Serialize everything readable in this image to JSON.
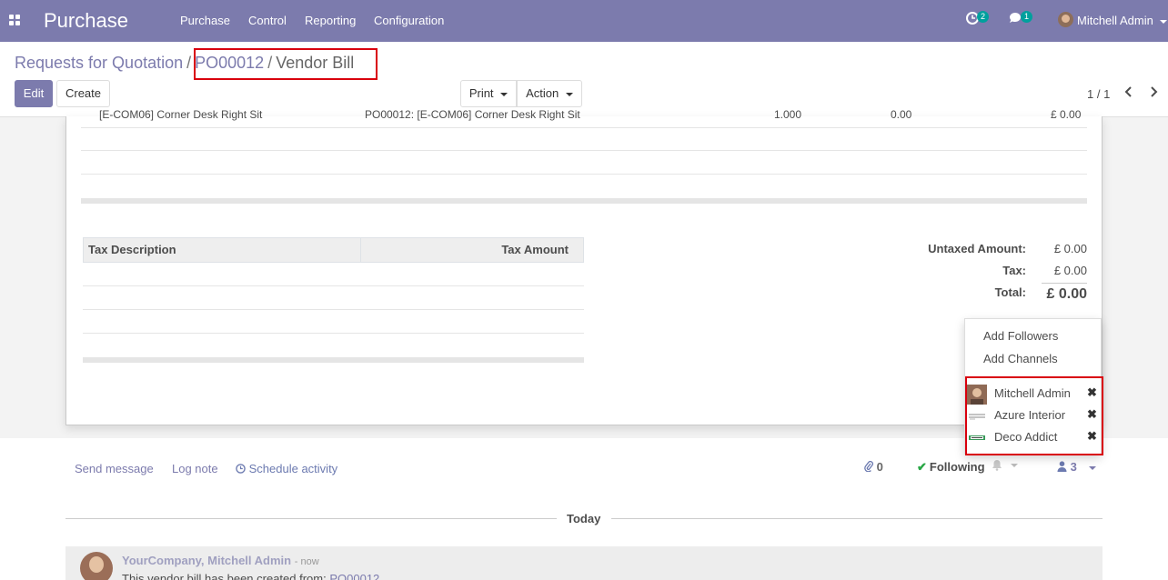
{
  "navbar": {
    "app_title": "Purchase",
    "menu": [
      "Purchase",
      "Control",
      "Reporting",
      "Configuration"
    ],
    "activity_count": "2",
    "message_count": "1",
    "user_name": "Mitchell Admin"
  },
  "breadcrumb": {
    "parent": "Requests for Quotation",
    "separator": "/",
    "record": "PO00012",
    "current": "Vendor Bill"
  },
  "buttons": {
    "edit": "Edit",
    "create": "Create",
    "print": "Print",
    "action": "Action"
  },
  "pager": {
    "value": "1 / 1"
  },
  "line_cut": {
    "product": "[E-COM06] Corner Desk Right Sit",
    "description": "PO00012: [E-COM06] Corner Desk Right Sit",
    "quantity": "1.000",
    "price": "0.00",
    "subtotal": "£ 0.00"
  },
  "tax_table": {
    "col_description": "Tax Description",
    "col_amount": "Tax Amount"
  },
  "totals": {
    "untaxed_label": "Untaxed Amount:",
    "untaxed_value": "£ 0.00",
    "tax_label": "Tax:",
    "tax_value": "£ 0.00",
    "total_label": "Total:",
    "total_value": "£ 0.00"
  },
  "chatter": {
    "send_message": "Send message",
    "log_note": "Log note",
    "schedule_activity": "Schedule activity",
    "attachments_count": "0",
    "following_label": "Following",
    "followers_count": "3"
  },
  "followers_dropdown": {
    "add_followers": "Add Followers",
    "add_channels": "Add Channels",
    "followers": [
      {
        "name": "Mitchell Admin"
      },
      {
        "name": "Azure Interior"
      },
      {
        "name": "Deco Addict"
      }
    ]
  },
  "timeline": {
    "today_label": "Today"
  },
  "message": {
    "author": "YourCompany, Mitchell Admin",
    "date": "- now",
    "body_prefix": "This vendor bill has been created from:",
    "body_link": "PO00012"
  },
  "colors": {
    "brand": "#7c7bad",
    "highlight": "#d9000d",
    "success": "#28a745",
    "badge": "#00a09d"
  }
}
